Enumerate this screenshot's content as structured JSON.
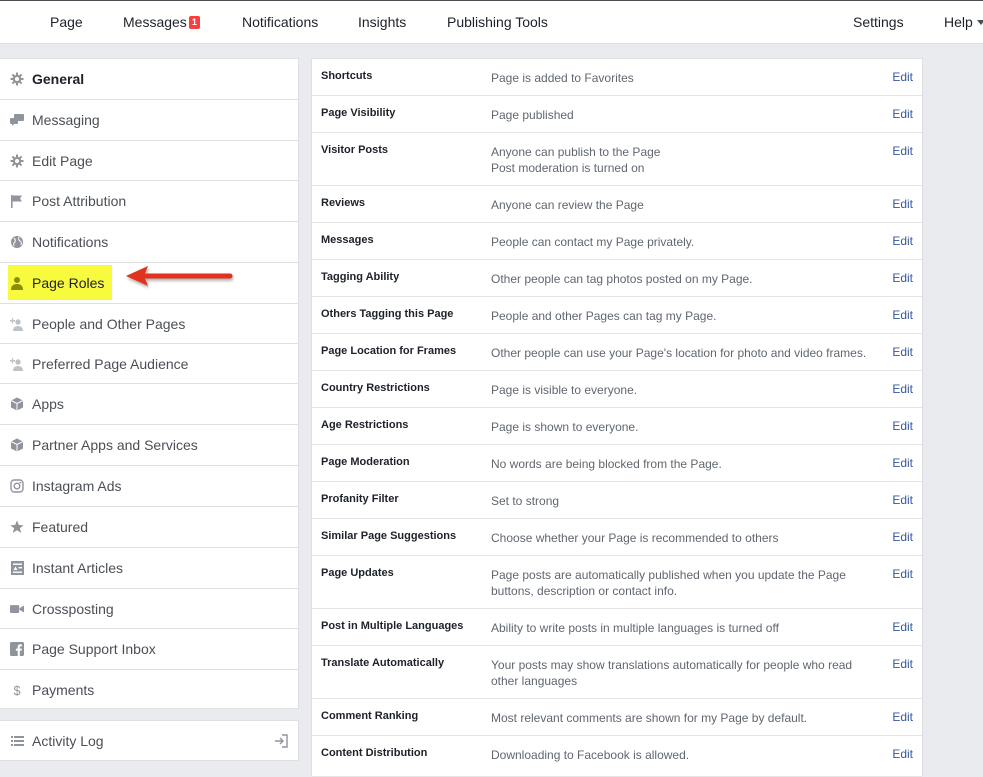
{
  "topnav": {
    "items": [
      {
        "label": "Page"
      },
      {
        "label": "Messages",
        "badge": "1"
      },
      {
        "label": "Notifications"
      },
      {
        "label": "Insights"
      },
      {
        "label": "Publishing Tools"
      }
    ],
    "settings_label": "Settings",
    "help_label": "Help"
  },
  "sidebar": {
    "items": [
      {
        "label": "General",
        "icon": "gear-icon"
      },
      {
        "label": "Messaging",
        "icon": "messaging-icon"
      },
      {
        "label": "Edit Page",
        "icon": "gear-icon"
      },
      {
        "label": "Post Attribution",
        "icon": "flag-icon"
      },
      {
        "label": "Notifications",
        "icon": "globe-icon"
      },
      {
        "label": "Page Roles",
        "icon": "person-icon"
      },
      {
        "label": "People and Other Pages",
        "icon": "person-add-icon"
      },
      {
        "label": "Preferred Page Audience",
        "icon": "person-add-icon"
      },
      {
        "label": "Apps",
        "icon": "cube-icon"
      },
      {
        "label": "Partner Apps and Services",
        "icon": "cube-icon"
      },
      {
        "label": "Instagram Ads",
        "icon": "instagram-icon"
      },
      {
        "label": "Featured",
        "icon": "star-icon"
      },
      {
        "label": "Instant Articles",
        "icon": "article-icon"
      },
      {
        "label": "Crossposting",
        "icon": "video-camera-icon"
      },
      {
        "label": "Page Support Inbox",
        "icon": "facebook-icon"
      },
      {
        "label": "Payments",
        "icon": "dollar-icon"
      }
    ],
    "activity_log": {
      "label": "Activity Log",
      "icon": "list-icon"
    }
  },
  "settings": {
    "edit_label": "Edit",
    "rows": [
      {
        "label": "Shortcuts",
        "value": "Page is added to Favorites"
      },
      {
        "label": "Page Visibility",
        "value": "Page published"
      },
      {
        "label": "Visitor Posts",
        "value": "Anyone can publish to the Page",
        "value2": "Post moderation is turned on"
      },
      {
        "label": "Reviews",
        "value": "Anyone can review the Page"
      },
      {
        "label": "Messages",
        "value": "People can contact my Page privately."
      },
      {
        "label": "Tagging Ability",
        "value": "Other people can tag photos posted on my Page."
      },
      {
        "label": "Others Tagging this Page",
        "value": "People and other Pages can tag my Page."
      },
      {
        "label": "Page Location for Frames",
        "value": "Other people can use your Page's location for photo and video frames."
      },
      {
        "label": "Country Restrictions",
        "value": "Page is visible to everyone."
      },
      {
        "label": "Age Restrictions",
        "value": "Page is shown to everyone."
      },
      {
        "label": "Page Moderation",
        "value": "No words are being blocked from the Page."
      },
      {
        "label": "Profanity Filter",
        "value": "Set to strong"
      },
      {
        "label": "Similar Page Suggestions",
        "value": "Choose whether your Page is recommended to others"
      },
      {
        "label": "Page Updates",
        "value": "Page posts are automatically published when you update the Page buttons, description or contact info."
      },
      {
        "label": "Post in Multiple Languages",
        "value": "Ability to write posts in multiple languages is turned off"
      },
      {
        "label": "Translate Automatically",
        "value": "Your posts may show translations automatically for people who read other languages"
      },
      {
        "label": "Comment Ranking",
        "value": "Most relevant comments are shown for my Page by default."
      },
      {
        "label": "Content Distribution",
        "value": "Downloading to Facebook is allowed."
      }
    ]
  },
  "colors": {
    "link": "#365899",
    "highlight": "#f8fa3e",
    "arrow": "#e0311c",
    "badge": "#fa3e3e"
  }
}
